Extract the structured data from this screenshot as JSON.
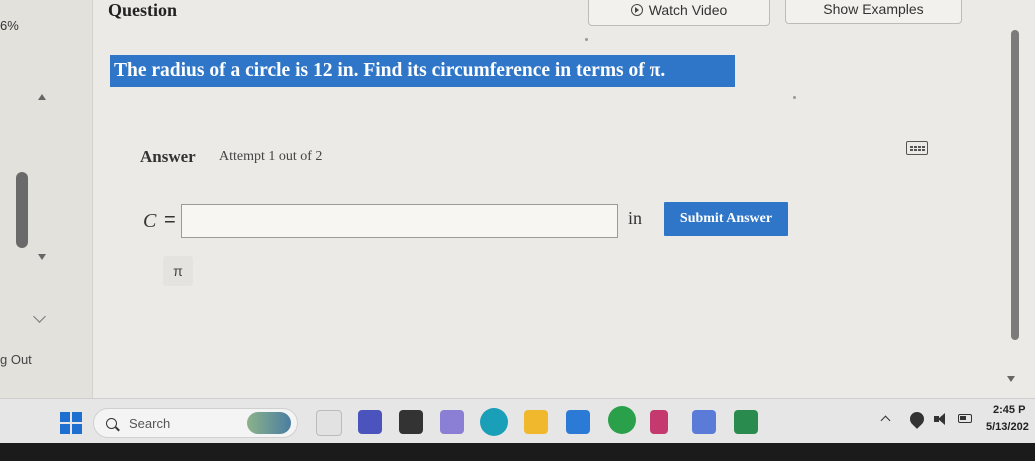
{
  "sidebar": {
    "percent": "6%",
    "logout": "g Out"
  },
  "header": {
    "title": "Question",
    "watch_video": "Watch Video",
    "show_examples": "Show Examples"
  },
  "question": {
    "text": "The radius of a circle is 12 in. Find its circumference in terms of π."
  },
  "answer": {
    "label": "Answer",
    "attempt": "Attempt 1 out of 2",
    "variable": "C",
    "equals": "=",
    "input_value": "",
    "unit": "in",
    "submit": "Submit Answer",
    "pi_symbol": "π"
  },
  "taskbar": {
    "search_placeholder": "Search",
    "time": "2:45 P",
    "date": "5/13/202",
    "icons": [
      "start-icon",
      "search-icon",
      "widget-icon",
      "teams-icon",
      "file-explorer-icon",
      "store-icon",
      "edge-icon",
      "folder-icon",
      "photos-icon",
      "chrome-icon",
      "app-icon",
      "mcafee-icon",
      "word-icon"
    ]
  },
  "colors": {
    "accent": "#2f76c8",
    "page_bg": "#eceae6",
    "taskbar_bg": "#e6e6e6"
  }
}
